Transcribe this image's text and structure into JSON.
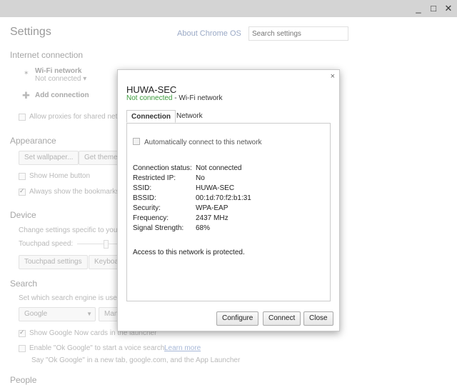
{
  "window": {
    "minimize_glyph": "_",
    "maximize_glyph": "□",
    "close_glyph": "✕"
  },
  "settings": {
    "title": "Settings",
    "about_link": "About Chrome OS",
    "search_placeholder": "Search settings",
    "internet": {
      "heading": "Internet connection",
      "wifi_label": "Wi-Fi network",
      "wifi_status": "Not connected ▾",
      "add_connection": "Add connection",
      "proxy_label": "Allow proxies for shared net"
    },
    "appearance": {
      "heading": "Appearance",
      "set_wallpaper": "Set wallpaper...",
      "get_themes": "Get themes",
      "show_home": "Show Home button",
      "show_bookmarks": "Always show the bookmarks"
    },
    "device": {
      "heading": "Device",
      "desc": "Change settings specific to your",
      "touchpad_speed": "Touchpad speed:",
      "touchpad_settings": "Touchpad settings",
      "keyboard": "Keyboa"
    },
    "search": {
      "heading": "Search",
      "desc": "Set which search engine is used",
      "engine": "Google",
      "manage": "Mana",
      "google_now": "Show Google Now cards in the launcher",
      "ok_google": "Enable \"Ok Google\" to start a voice search.",
      "learn_more": "Learn more",
      "ok_google_hint": "Say \"Ok Google\" in a new tab, google.com, and the App Launcher"
    },
    "people": {
      "heading": "People"
    }
  },
  "dialog": {
    "close_glyph": "×",
    "title": "HUWA-SEC",
    "status_state": "Not connected",
    "status_suffix": " - Wi-Fi network",
    "tabs": [
      "Connection",
      "Network"
    ],
    "auto_connect": "Automatically connect to this network",
    "rows": [
      {
        "label": "Connection status:",
        "value": "Not connected"
      },
      {
        "label": "Restricted IP:",
        "value": "No"
      },
      {
        "label": "SSID:",
        "value": "HUWA-SEC"
      },
      {
        "label": "BSSID:",
        "value": "00:1d:70:f2:b1:31"
      },
      {
        "label": "Security:",
        "value": "WPA-EAP"
      },
      {
        "label": "Frequency:",
        "value": "2437 MHz"
      },
      {
        "label": "Signal Strength:",
        "value": "68%"
      }
    ],
    "protected_note": "Access to this network is protected.",
    "buttons": {
      "configure": "Configure",
      "connect": "Connect",
      "close": "Close"
    }
  }
}
